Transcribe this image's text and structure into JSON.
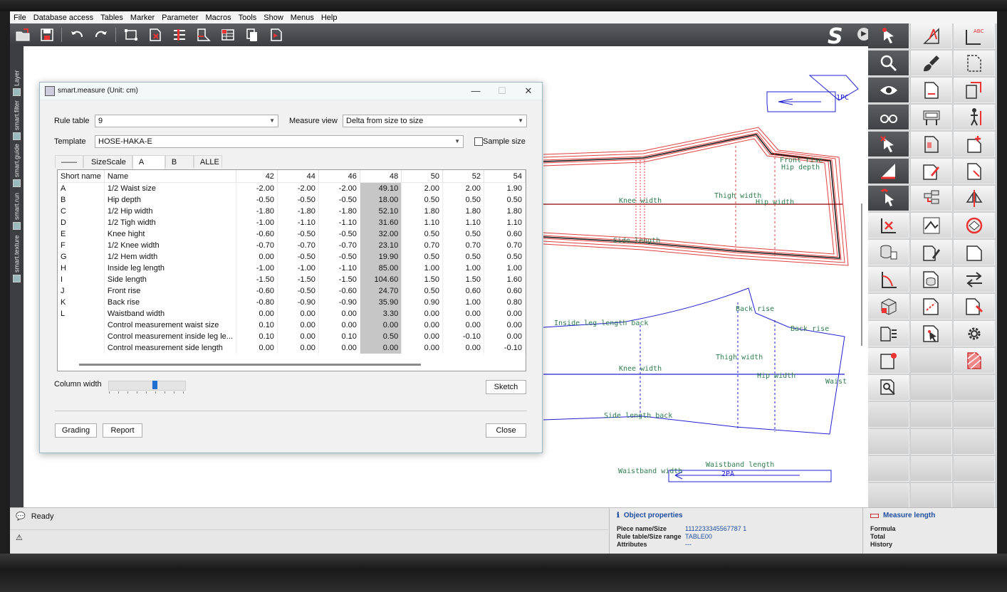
{
  "menu": [
    "File",
    "Database access",
    "Tables",
    "Marker",
    "Parameter",
    "Macros",
    "Tools",
    "Show",
    "Menus",
    "Help"
  ],
  "vertical_tabs": [
    "Layer",
    "smart.filter",
    "smart.guide",
    "smart.run",
    "smart.texture"
  ],
  "dialog": {
    "title": "smart.measure (Unit: cm)",
    "rule_table_label": "Rule table",
    "rule_table_value": "9",
    "measure_view_label": "Measure view",
    "measure_view_value": "Delta from size to size",
    "template_label": "Template",
    "template_value": "HOSE-HAKA-E",
    "sample_size_label": "Sample size",
    "tabs": [
      "——",
      "SizeScale",
      "A",
      "B",
      "ALLE"
    ],
    "columns": [
      "Short name",
      "Name",
      "42",
      "44",
      "46",
      "48",
      "50",
      "52",
      "54"
    ],
    "rows": [
      [
        "A",
        "1/2 Waist size",
        "-2.00",
        "-2.00",
        "-2.00",
        "49.10",
        "2.00",
        "2.00",
        "1.90"
      ],
      [
        "B",
        "Hip depth",
        "-0.50",
        "-0.50",
        "-0.50",
        "18.00",
        "0.50",
        "0.50",
        "0.50"
      ],
      [
        "C",
        "1/2 Hip width",
        "-1.80",
        "-1.80",
        "-1.80",
        "52.10",
        "1.80",
        "1.80",
        "1.80"
      ],
      [
        "D",
        "1/2 Tigh width",
        "-1.00",
        "-1.10",
        "-1.10",
        "31.60",
        "1.10",
        "1.10",
        "1.10"
      ],
      [
        "E",
        "Knee hight",
        "-0.60",
        "-0.50",
        "-0.50",
        "32.00",
        "0.50",
        "0.50",
        "0.60"
      ],
      [
        "F",
        "1/2 Knee width",
        "-0.70",
        "-0.70",
        "-0.70",
        "23.10",
        "0.70",
        "0.70",
        "0.70"
      ],
      [
        "G",
        "1/2 Hem width",
        "0.00",
        "-0.50",
        "-0.50",
        "19.90",
        "0.50",
        "0.50",
        "0.50"
      ],
      [
        "H",
        "Inside leg length",
        "-1.00",
        "-1.00",
        "-1.10",
        "85.00",
        "1.00",
        "1.00",
        "1.00"
      ],
      [
        "I",
        "Side length",
        "-1.50",
        "-1.50",
        "-1.50",
        "104.60",
        "1.50",
        "1.50",
        "1.60"
      ],
      [
        "J",
        "Front rise",
        "-0.60",
        "-0.50",
        "-0.60",
        "24.70",
        "0.50",
        "0.60",
        "0.60"
      ],
      [
        "K",
        "Back rise",
        "-0.80",
        "-0.90",
        "-0.90",
        "35.90",
        "0.90",
        "1.00",
        "0.80"
      ],
      [
        "L",
        "Waistband width",
        "0.00",
        "0.00",
        "0.00",
        "3.30",
        "0.00",
        "0.00",
        "0.00"
      ],
      [
        "",
        "Control measurement waist size",
        "0.10",
        "0.00",
        "0.00",
        "0.00",
        "0.00",
        "0.00",
        "0.00"
      ],
      [
        "",
        "Control measurement inside leg le...",
        "0.10",
        "0.00",
        "0.10",
        "0.50",
        "0.00",
        "-0.10",
        "0.00"
      ],
      [
        "",
        "Control measurement side length",
        "0.00",
        "0.00",
        "0.00",
        "0.00",
        "0.00",
        "0.00",
        "-0.10"
      ]
    ],
    "column_width_label": "Column width",
    "sketch_button": "Sketch",
    "grading_button": "Grading",
    "report_button": "Report",
    "close_button": "Close"
  },
  "canvas_labels": {
    "knee_width": "Knee width",
    "thigh_width": "Thigh width",
    "hip_width": "Hip width",
    "side_length": "Side length",
    "front_rise": "Front rise",
    "hip_depth": "Hip depth",
    "inside_leg_length_back": "Inside leg length back",
    "back_rise": "Back rise",
    "waist": "Waist",
    "side_length_back": "Side length back",
    "waistband_length": "Waistband length",
    "waistband_width": "Waistband width",
    "piece_code_1": "1PC",
    "piece_code_2": "2PA"
  },
  "status": {
    "ready": "Ready",
    "object_properties_title": "Object properties",
    "piece_name_label": "Piece name/Size",
    "piece_name_value": "1112233345567787 1",
    "rule_table_label": "Rule table/Size range",
    "rule_table_value": "TABLE00",
    "attributes_label": "Attributes",
    "attributes_value": "---",
    "measure_length_title": "Measure length",
    "formula_label": "Formula",
    "total_label": "Total",
    "history_label": "History"
  },
  "colors": {
    "pattern_red": "#e04040",
    "pattern_blue": "#2020d0",
    "label_green": "#2e7d4f",
    "highlight_cell": "#c6c6c6",
    "accent_blue": "#1f4fa0"
  }
}
